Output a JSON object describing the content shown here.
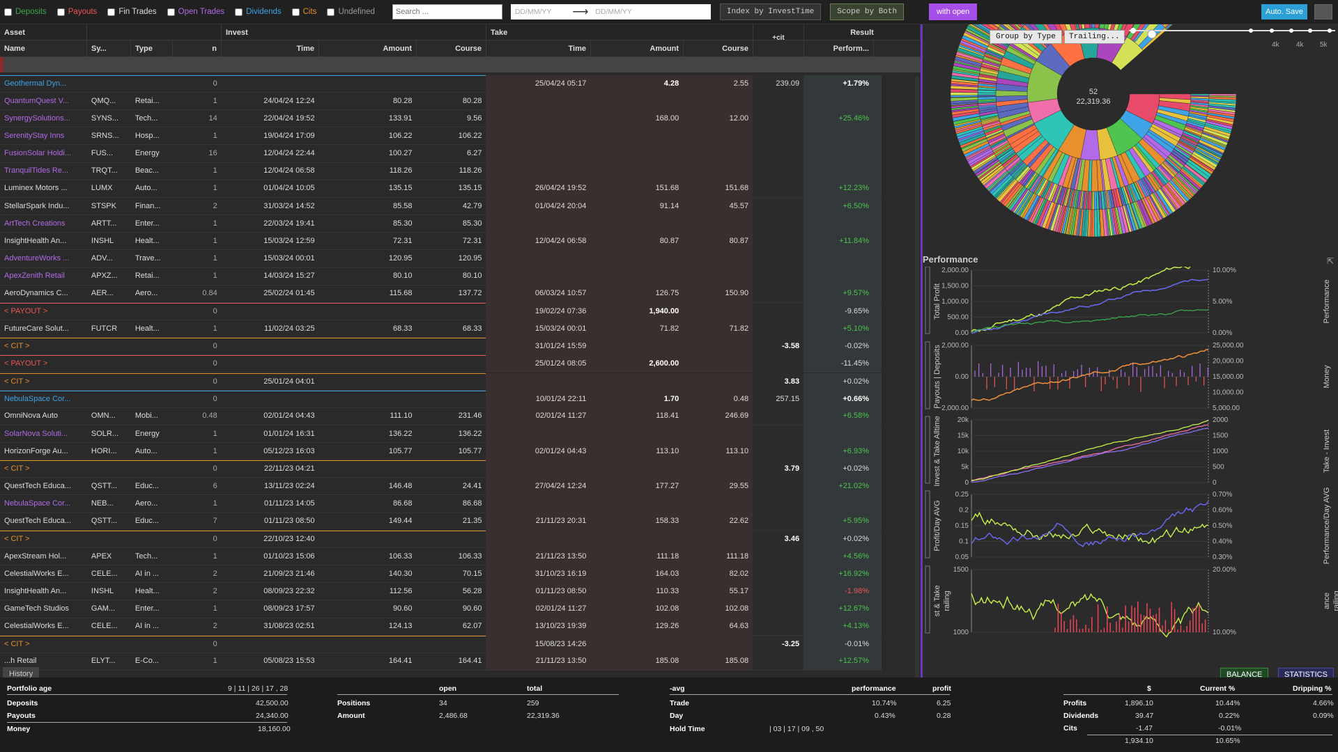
{
  "filters": [
    {
      "label": "Deposits",
      "color": "#3aa84a",
      "checked": false
    },
    {
      "label": "Payouts",
      "color": "#ee5555",
      "checked": false
    },
    {
      "label": "Fin Trades",
      "color": "#dddddd",
      "checked": false
    },
    {
      "label": "Open Trades",
      "color": "#b36ae8",
      "checked": false
    },
    {
      "label": "Dividends",
      "color": "#3fa3e8",
      "checked": false
    },
    {
      "label": "Cits",
      "color": "#e8902d",
      "checked": false
    },
    {
      "label": "Undefined",
      "color": "#999999",
      "checked": false
    }
  ],
  "search": {
    "placeholder": "Search ..."
  },
  "daterange": {
    "from_placeholder": "DD/MM/YY",
    "to_placeholder": "DD/MM/YY"
  },
  "toolbar": {
    "index_label": "Index by InvestTime",
    "scope_label": "Scope by Both",
    "with_open_label": "with open",
    "autosave_label": "Auto. Save"
  },
  "table": {
    "group_headers": {
      "asset": "Asset",
      "invest": "Invest",
      "take": "Take",
      "result": "Result",
      "cit": "+cit"
    },
    "columns": {
      "name": "Name",
      "symbol": "Sy...",
      "type": "Type",
      "n": "n",
      "invest_time": "Time",
      "invest_amount": "Amount",
      "invest_course": "Course",
      "take_time": "Time",
      "take_amount": "Amount",
      "take_course": "Course",
      "perf": "Perform..."
    },
    "rows": [
      {
        "name": "Geothermal Dyn...",
        "nc": "blue",
        "sym": "",
        "type": "",
        "n": "0",
        "it": "",
        "ia": "",
        "ic": "",
        "tt": "25/04/24 05:17",
        "ta": "4.28",
        "tc": "2.55",
        "cit": "239.09",
        "perf": "+1.79%",
        "pc": "bold",
        "tab": true,
        "line": "#3fa3e8"
      },
      {
        "name": "QuantumQuest V...",
        "nc": "purple",
        "sym": "QMQ...",
        "type": "Retai...",
        "n": "1",
        "it": "24/04/24 12:24",
        "ia": "80.28",
        "ic": "80.28",
        "tt": "",
        "ta": "",
        "tc": "",
        "cit": "",
        "perf": "",
        "pc": ""
      },
      {
        "name": "SynergySolutions...",
        "nc": "purple",
        "sym": "SYNS...",
        "type": "Tech...",
        "n": "14",
        "it": "22/04/24 19:52",
        "ia": "133.91",
        "ic": "9.56",
        "tt": "",
        "ta": "168.00",
        "tc": "12.00",
        "cit": "",
        "perf": "+25.46%",
        "pc": "green"
      },
      {
        "name": "SerenityStay Inns",
        "nc": "purple",
        "sym": "SRNS...",
        "type": "Hosp...",
        "n": "1",
        "it": "19/04/24 17:09",
        "ia": "106.22",
        "ic": "106.22",
        "tt": "",
        "ta": "",
        "tc": "",
        "cit": "",
        "perf": "",
        "pc": ""
      },
      {
        "name": "FusionSolar Holdi...",
        "nc": "purple",
        "sym": "FUS...",
        "type": "Energy",
        "n": "16",
        "it": "12/04/24 22:44",
        "ia": "100.27",
        "ic": "6.27",
        "tt": "",
        "ta": "",
        "tc": "",
        "cit": "",
        "perf": "",
        "pc": ""
      },
      {
        "name": "TranquilTides Re...",
        "nc": "purple",
        "sym": "TRQT...",
        "type": "Beac...",
        "n": "1",
        "it": "12/04/24 06:58",
        "ia": "118.26",
        "ic": "118.26",
        "tt": "",
        "ta": "",
        "tc": "",
        "cit": "",
        "perf": "",
        "pc": ""
      },
      {
        "name": "Luminex Motors ...",
        "nc": "",
        "sym": "LUMX",
        "type": "Auto...",
        "n": "1",
        "it": "01/04/24 10:05",
        "ia": "135.15",
        "ic": "135.15",
        "tt": "26/04/24 19:52",
        "ta": "151.68",
        "tc": "151.68",
        "cit": "",
        "perf": "+12.23%",
        "pc": "green"
      },
      {
        "name": "StellarSpark Indu...",
        "nc": "",
        "sym": "STSPK",
        "type": "Finan...",
        "n": "2",
        "it": "31/03/24 14:52",
        "ia": "85.58",
        "ic": "42.79",
        "tt": "01/04/24 20:04",
        "ta": "91.14",
        "tc": "45.57",
        "cit": "",
        "perf": "+6.50%",
        "pc": "green"
      },
      {
        "name": "ArtTech Creations",
        "nc": "purple",
        "sym": "ARTT...",
        "type": "Enter...",
        "n": "1",
        "it": "22/03/24 19:41",
        "ia": "85.30",
        "ic": "85.30",
        "tt": "",
        "ta": "",
        "tc": "",
        "cit": "",
        "perf": "",
        "pc": ""
      },
      {
        "name": "InsightHealth An...",
        "nc": "",
        "sym": "INSHL",
        "type": "Healt...",
        "n": "1",
        "it": "15/03/24 12:59",
        "ia": "72.31",
        "ic": "72.31",
        "tt": "12/04/24 06:58",
        "ta": "80.87",
        "tc": "80.87",
        "cit": "",
        "perf": "+11.84%",
        "pc": "green"
      },
      {
        "name": "AdventureWorks ...",
        "nc": "purple",
        "sym": "ADV...",
        "type": "Trave...",
        "n": "1",
        "it": "15/03/24 00:01",
        "ia": "120.95",
        "ic": "120.95",
        "tt": "",
        "ta": "",
        "tc": "",
        "cit": "",
        "perf": "",
        "pc": ""
      },
      {
        "name": "ApexZenith Retail",
        "nc": "purple",
        "sym": "APXZ...",
        "type": "Retai...",
        "n": "1",
        "it": "14/03/24 15:27",
        "ia": "80.10",
        "ic": "80.10",
        "tt": "",
        "ta": "",
        "tc": "",
        "cit": "",
        "perf": "",
        "pc": ""
      },
      {
        "name": "AeroDynamics C...",
        "nc": "",
        "sym": "AER...",
        "type": "Aero...",
        "n": "0.84",
        "it": "25/02/24 01:45",
        "ia": "115.68",
        "ic": "137.72",
        "tt": "06/03/24 10:57",
        "ta": "126.75",
        "tc": "150.90",
        "cit": "",
        "perf": "+9.57%",
        "pc": "green"
      },
      {
        "name": "< PAYOUT >",
        "nc": "red",
        "sym": "",
        "type": "",
        "n": "0",
        "it": "",
        "ia": "",
        "ic": "",
        "tt": "19/02/24 07:36",
        "ta": "1,940.00",
        "tc": "",
        "cit": "",
        "perf": "-9.65%",
        "pc": "",
        "tab": true,
        "line": "#ee5555",
        "tabold": true
      },
      {
        "name": "FutureCare Solut...",
        "nc": "",
        "sym": "FUTCR",
        "type": "Healt...",
        "n": "1",
        "it": "11/02/24 03:25",
        "ia": "68.33",
        "ic": "68.33",
        "tt": "15/03/24 00:01",
        "ta": "71.82",
        "tc": "71.82",
        "cit": "",
        "perf": "+5.10%",
        "pc": "green"
      },
      {
        "name": "< CIT >",
        "nc": "orange",
        "sym": "",
        "type": "",
        "n": "0",
        "it": "",
        "ia": "",
        "ic": "",
        "tt": "31/01/24 15:59",
        "ta": "",
        "tc": "",
        "cit": "-3.58",
        "perf": "-0.02%",
        "pc": "",
        "tab": true,
        "line": "#e8902d",
        "citbold": true
      },
      {
        "name": "< PAYOUT >",
        "nc": "red",
        "sym": "",
        "type": "",
        "n": "0",
        "it": "",
        "ia": "",
        "ic": "",
        "tt": "25/01/24 08:05",
        "ta": "2,600.00",
        "tc": "",
        "cit": "",
        "perf": "-11.45%",
        "pc": "",
        "tab": true,
        "line": "#ee5555",
        "tabold": true
      },
      {
        "name": "< CIT >",
        "nc": "orange",
        "sym": "",
        "type": "",
        "n": "0",
        "it": "25/01/24 04:01",
        "ia": "",
        "ic": "",
        "tt": "",
        "ta": "",
        "tc": "",
        "cit": "3.83",
        "perf": "+0.02%",
        "pc": "",
        "tab": true,
        "line": "#e8902d",
        "citbold": true
      },
      {
        "name": "NebulaSpace Cor...",
        "nc": "blue",
        "sym": "",
        "type": "",
        "n": "0",
        "it": "",
        "ia": "",
        "ic": "",
        "tt": "10/01/24 22:11",
        "ta": "1.70",
        "tc": "0.48",
        "cit": "257.15",
        "perf": "+0.66%",
        "pc": "bold",
        "tab": true,
        "line": "#3fa3e8",
        "tabold": true
      },
      {
        "name": "OmniNova Auto",
        "nc": "",
        "sym": "OMN...",
        "type": "Mobi...",
        "n": "0.48",
        "it": "02/01/24 04:43",
        "ia": "111.10",
        "ic": "231.46",
        "tt": "02/01/24 11:27",
        "ta": "118.41",
        "tc": "246.69",
        "cit": "",
        "perf": "+6.58%",
        "pc": "green"
      },
      {
        "name": "SolarNova Soluti...",
        "nc": "purple",
        "sym": "SOLR...",
        "type": "Energy",
        "n": "1",
        "it": "01/01/24 16:31",
        "ia": "136.22",
        "ic": "136.22",
        "tt": "",
        "ta": "",
        "tc": "",
        "cit": "",
        "perf": "",
        "pc": ""
      },
      {
        "name": "HorizonForge Au...",
        "nc": "",
        "sym": "HORI...",
        "type": "Auto...",
        "n": "1",
        "it": "05/12/23 16:03",
        "ia": "105.77",
        "ic": "105.77",
        "tt": "02/01/24 04:43",
        "ta": "113.10",
        "tc": "113.10",
        "cit": "",
        "perf": "+6.93%",
        "pc": "green"
      },
      {
        "name": "< CIT >",
        "nc": "orange",
        "sym": "",
        "type": "",
        "n": "0",
        "it": "22/11/23 04:21",
        "ia": "",
        "ic": "",
        "tt": "",
        "ta": "",
        "tc": "",
        "cit": "3.79",
        "perf": "+0.02%",
        "pc": "",
        "tab": true,
        "line": "#e8902d",
        "citbold": true
      },
      {
        "name": "QuestTech Educa...",
        "nc": "",
        "sym": "QSTT...",
        "type": "Educ...",
        "n": "6",
        "it": "13/11/23 02:24",
        "ia": "146.48",
        "ic": "24.41",
        "tt": "27/04/24 12:24",
        "ta": "177.27",
        "tc": "29.55",
        "cit": "",
        "perf": "+21.02%",
        "pc": "green"
      },
      {
        "name": "NebulaSpace Cor...",
        "nc": "purple",
        "sym": "NEB...",
        "type": "Aero...",
        "n": "1",
        "it": "01/11/23 14:05",
        "ia": "86.68",
        "ic": "86.68",
        "tt": "",
        "ta": "",
        "tc": "",
        "cit": "",
        "perf": "",
        "pc": ""
      },
      {
        "name": "QuestTech Educa...",
        "nc": "",
        "sym": "QSTT...",
        "type": "Educ...",
        "n": "7",
        "it": "01/11/23 08:50",
        "ia": "149.44",
        "ic": "21.35",
        "tt": "21/11/23 20:31",
        "ta": "158.33",
        "tc": "22.62",
        "cit": "",
        "perf": "+5.95%",
        "pc": "green"
      },
      {
        "name": "< CIT >",
        "nc": "orange",
        "sym": "",
        "type": "",
        "n": "0",
        "it": "22/10/23 12:40",
        "ia": "",
        "ic": "",
        "tt": "",
        "ta": "",
        "tc": "",
        "cit": "3.46",
        "perf": "+0.02%",
        "pc": "",
        "tab": true,
        "line": "#e8902d",
        "citbold": true
      },
      {
        "name": "ApexStream Hol...",
        "nc": "",
        "sym": "APEX",
        "type": "Tech...",
        "n": "1",
        "it": "01/10/23 15:06",
        "ia": "106.33",
        "ic": "106.33",
        "tt": "21/11/23 13:50",
        "ta": "111.18",
        "tc": "111.18",
        "cit": "",
        "perf": "+4.56%",
        "pc": "green"
      },
      {
        "name": "CelestialWorks E...",
        "nc": "",
        "sym": "CELE...",
        "type": "AI in ...",
        "n": "2",
        "it": "21/09/23 21:46",
        "ia": "140.30",
        "ic": "70.15",
        "tt": "31/10/23 16:19",
        "ta": "164.03",
        "tc": "82.02",
        "cit": "",
        "perf": "+16.92%",
        "pc": "green"
      },
      {
        "name": "InsightHealth An...",
        "nc": "",
        "sym": "INSHL",
        "type": "Healt...",
        "n": "2",
        "it": "08/09/23 22:32",
        "ia": "112.56",
        "ic": "56.28",
        "tt": "01/11/23 08:50",
        "ta": "110.33",
        "tc": "55.17",
        "cit": "",
        "perf": "-1.98%",
        "pc": "red"
      },
      {
        "name": "GameTech Studios",
        "nc": "",
        "sym": "GAM...",
        "type": "Enter...",
        "n": "1",
        "it": "08/09/23 17:57",
        "ia": "90.60",
        "ic": "90.60",
        "tt": "02/01/24 11:27",
        "ta": "102.08",
        "tc": "102.08",
        "cit": "",
        "perf": "+12.67%",
        "pc": "green"
      },
      {
        "name": "CelestialWorks E...",
        "nc": "",
        "sym": "CELE...",
        "type": "AI in ...",
        "n": "2",
        "it": "31/08/23 02:51",
        "ia": "124.13",
        "ic": "62.07",
        "tt": "13/10/23 19:39",
        "ta": "129.26",
        "tc": "64.63",
        "cit": "",
        "perf": "+4.13%",
        "pc": "green"
      },
      {
        "name": "< CIT >",
        "nc": "orange",
        "sym": "",
        "type": "",
        "n": "0",
        "it": "",
        "ia": "",
        "ic": "",
        "tt": "15/08/23 14:26",
        "ta": "",
        "tc": "",
        "cit": "-3.25",
        "perf": "-0.01%",
        "pc": "",
        "tab": true,
        "line": "#e8902d",
        "citbold": true
      },
      {
        "name": "...h Retail",
        "nc": "",
        "sym": "ELYT...",
        "type": "E-Co...",
        "n": "1",
        "it": "05/08/23 15:53",
        "ia": "164.41",
        "ic": "164.41",
        "tt": "21/11/23 13:50",
        "ta": "185.08",
        "tc": "185.08",
        "cit": "",
        "perf": "+12.57%",
        "pc": "green"
      }
    ]
  },
  "history_label": "History",
  "sunburst": {
    "group_label": "Group by Type",
    "trailing_label": "Trailing...",
    "center_count": "52",
    "center_value": "22,319.36",
    "slider_ticks": [
      "4k",
      "4k",
      "5k"
    ]
  },
  "performance": {
    "title": "Performance",
    "panels": [
      {
        "left_label": "Total Profit",
        "right_label": "Performance",
        "left_ticks": [
          "2,000.00",
          "1,500.00",
          "1,000.00",
          "500.00",
          "0.00"
        ],
        "right_ticks": [
          "10.00%",
          "5.00%",
          "0.00%"
        ]
      },
      {
        "left_label": "Payouts | Deposits",
        "right_label": "Money",
        "left_ticks": [
          "2,000.00",
          "0.00",
          "−2,000.00"
        ],
        "right_ticks": [
          "25,000.00",
          "20,000.00",
          "15,000.00",
          "10,000.00",
          "5,000.00"
        ]
      },
      {
        "left_label": "Invest & Take Alltime",
        "right_label": "Take - Invest",
        "left_ticks": [
          "20k",
          "15k",
          "10k",
          "5k",
          "0"
        ],
        "right_ticks": [
          "2000",
          "1500",
          "1000",
          "500",
          "0"
        ]
      },
      {
        "left_label": "Profit/Day AVG",
        "right_label": "Performance/Day AVG",
        "left_ticks": [
          "0.25",
          "0.2",
          "0.15",
          "0.1",
          "0.05"
        ],
        "right_ticks": [
          "0.70%",
          "0.60%",
          "0.50%",
          "0.40%",
          "0.30%"
        ]
      },
      {
        "left_label": "st & Take",
        "right_label": "ance",
        "left_label2": "railing",
        "right_label2": "railing",
        "left_ticks": [
          "1500",
          "1000"
        ],
        "right_ticks": [
          "20.00%",
          "10.00%"
        ]
      }
    ],
    "balance_label": "BALANCE",
    "statistics_label": "STATISTICS"
  },
  "stats": {
    "portfolio": {
      "age_label": "Portfolio age",
      "age_value": "9 | 11 | 26 | 17 , 28",
      "rows": [
        {
          "label": "Deposits",
          "value": "42,500.00"
        },
        {
          "label": "Payouts",
          "value": "24,340.00"
        },
        {
          "label": "Money",
          "value": "18,160.00"
        }
      ]
    },
    "positions": {
      "h_open": "open",
      "h_total": "total",
      "rows": [
        {
          "label": "Positions",
          "open": "34",
          "total": "259"
        },
        {
          "label": "Amount",
          "open": "2,486.68",
          "total": "22,319.36"
        }
      ]
    },
    "averages": {
      "h_label": "-avg",
      "h_perf": "performance",
      "h_profit": "profit",
      "rows": [
        {
          "label": "Trade",
          "perf": "10.74%",
          "profit": "6.25"
        },
        {
          "label": "Day",
          "perf": "0.43%",
          "profit": "0.28"
        }
      ],
      "hold_label": "Hold Time",
      "hold_value": "| 03 | 17 | 09 , 50"
    },
    "profits": {
      "h_usd": "$",
      "h_current": "Current %",
      "h_dripping": "Dripping %",
      "rows": [
        {
          "label": "Profits",
          "usd": "1,896.10",
          "current": "10.44%",
          "dripping": "4.66%"
        },
        {
          "label": "Dividends",
          "usd": "39.47",
          "current": "0.22%",
          "dripping": "0.09%"
        },
        {
          "label": "Cits",
          "usd": "-1.47",
          "current": "-0.01%",
          "dripping": ""
        }
      ],
      "total_usd": "1,934.10",
      "total_current": "10.65%"
    }
  }
}
